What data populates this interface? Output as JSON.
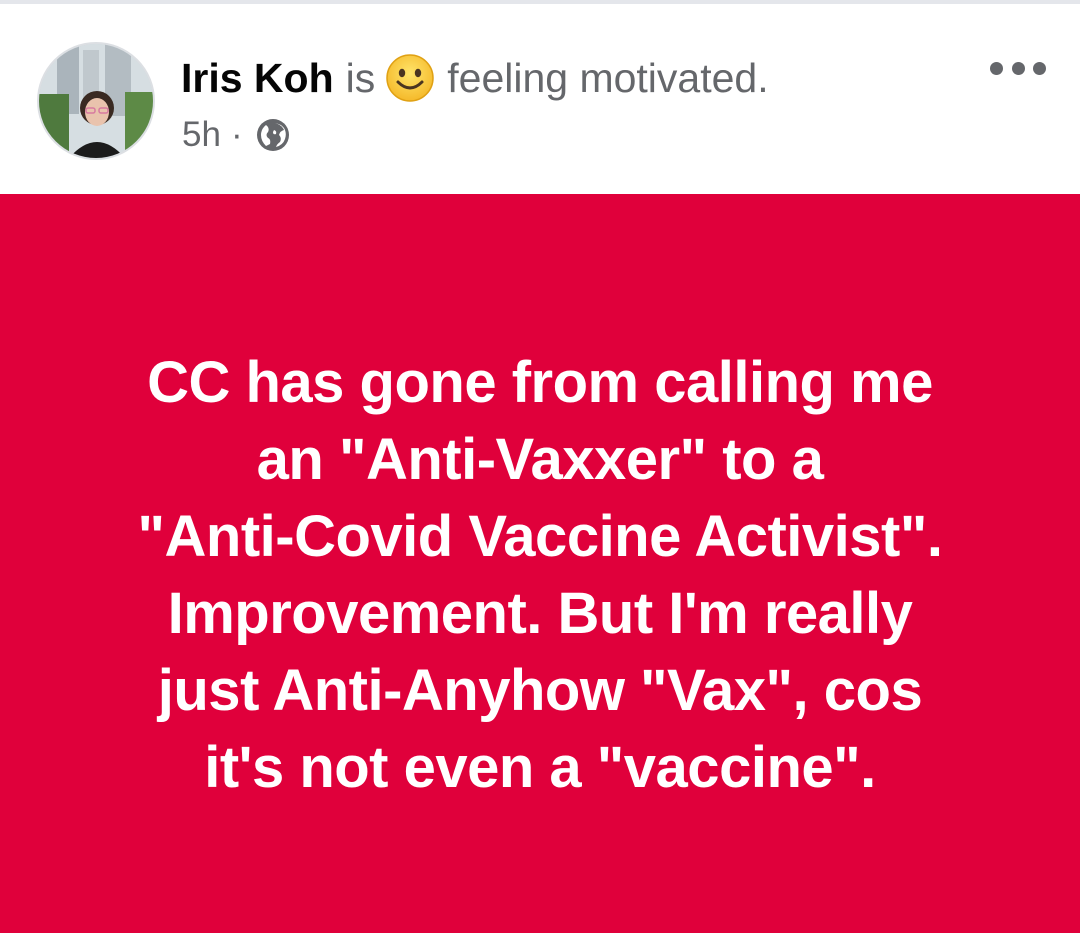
{
  "post": {
    "author": "Iris Koh",
    "feeling_prefix": "is",
    "feeling_emoji": "smiling-face-icon",
    "feeling_text": "feeling motivated.",
    "timestamp": "5h",
    "separator": "·",
    "audience_icon": "globe-icon",
    "menu_icon": "more-horizontal-icon",
    "status_text": "CC has gone from calling me\nan \"Anti-Vaxxer\" to a\n\"Anti-Covid Vaccine Activist\".\nImprovement. But I'm really\njust Anti-Anyhow \"Vax\", cos\nit's not even a \"vaccine\".",
    "background_color": "#e0003b",
    "text_color": "#ffffff"
  }
}
